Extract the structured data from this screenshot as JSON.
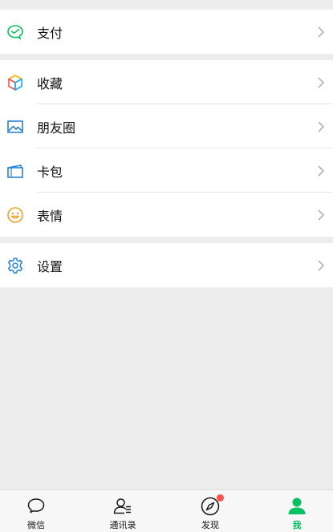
{
  "menu": {
    "group1": [
      {
        "label": "支付",
        "icon": "pay-icon"
      }
    ],
    "group2": [
      {
        "label": "收藏",
        "icon": "favorites-icon"
      },
      {
        "label": "朋友圈",
        "icon": "moments-icon"
      },
      {
        "label": "卡包",
        "icon": "card-wallet-icon"
      },
      {
        "label": "表情",
        "icon": "sticker-icon"
      }
    ],
    "group3": [
      {
        "label": "设置",
        "icon": "settings-icon"
      }
    ]
  },
  "tabbar": {
    "tabs": [
      {
        "label": "微信",
        "icon": "chat-bubble-icon",
        "active": false
      },
      {
        "label": "通讯录",
        "icon": "contacts-icon",
        "active": false
      },
      {
        "label": "发现",
        "icon": "compass-icon",
        "active": false,
        "badge": true
      },
      {
        "label": "我",
        "icon": "me-icon",
        "active": true
      }
    ]
  },
  "colors": {
    "accent": "#07c160",
    "badge": "#fa5151",
    "background": "#ededed"
  }
}
